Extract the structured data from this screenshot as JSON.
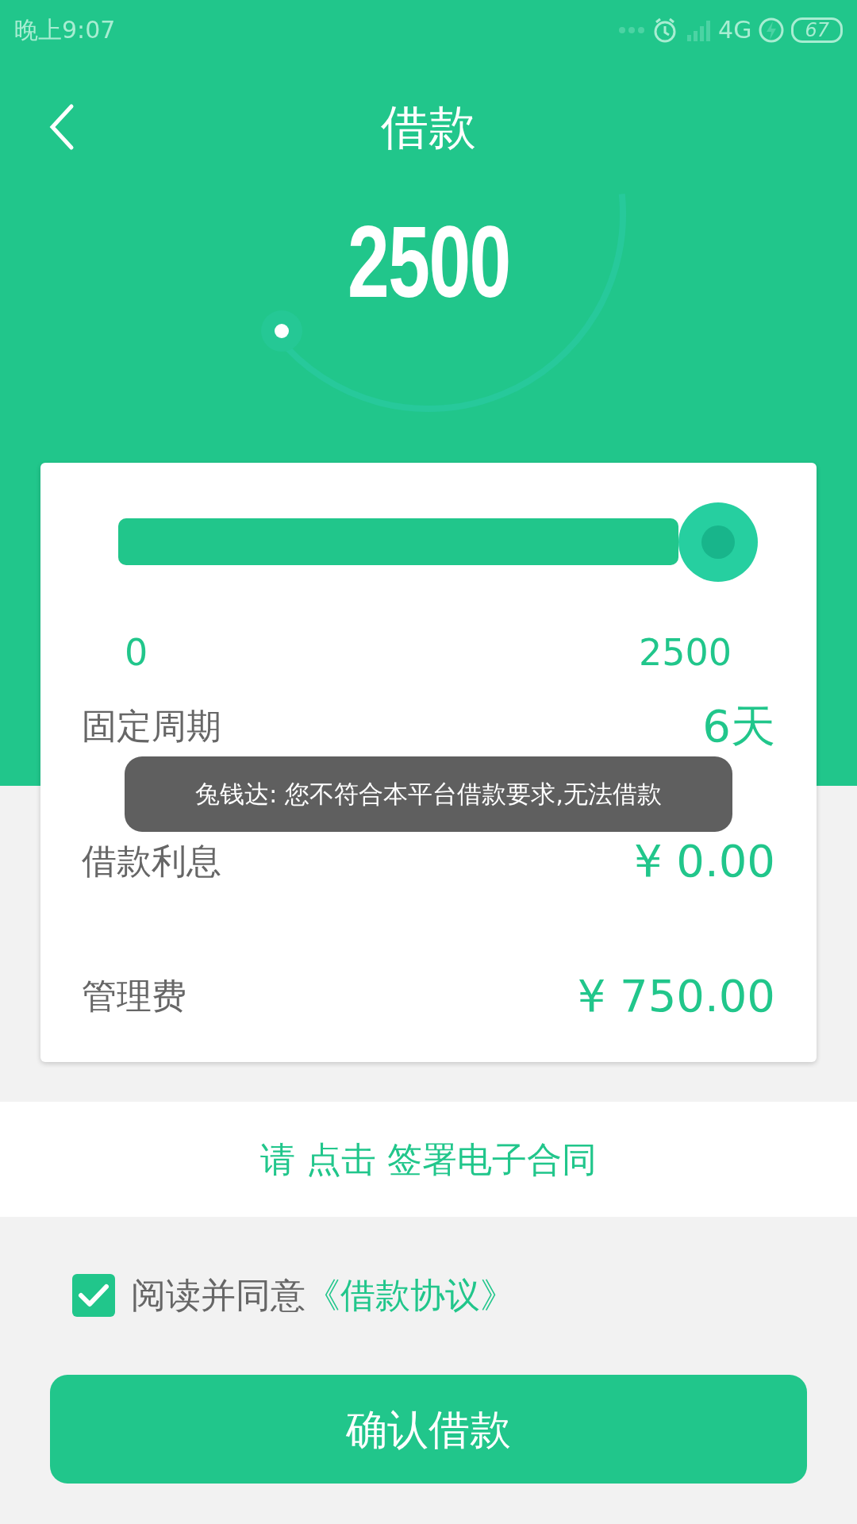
{
  "status_bar": {
    "time": "晚上9:07",
    "network": "4G",
    "battery": "67"
  },
  "header": {
    "title": "借款"
  },
  "amount": "2500",
  "slider": {
    "level": 1,
    "min_label": "0",
    "max_label": "2500"
  },
  "rows": [
    {
      "label": "固定周期",
      "value": "6天"
    },
    {
      "label": "借款利息",
      "value": "¥ 0.00"
    },
    {
      "label": "管理费",
      "value": "¥ 750.00"
    }
  ],
  "toast": "兔钱达: 您不符合本平台借款要求,无法借款",
  "contract_link": "请 点击 签署电子合同",
  "agreement": {
    "checked": true,
    "text": "阅读并同意",
    "link": "《借款协议》"
  },
  "confirm_button": "确认借款"
}
